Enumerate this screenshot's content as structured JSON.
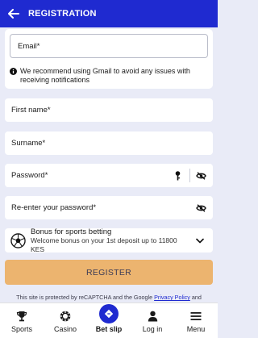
{
  "header": {
    "title": "REGISTRATION"
  },
  "email": {
    "label": "Email*",
    "notice": "We recommend using Gmail to avoid any issues with receiving notifications"
  },
  "fields": {
    "first_name": "First name*",
    "surname": "Surname*",
    "password": "Password*",
    "reenter_password": "Re-enter your password*"
  },
  "bonus": {
    "title": "Bonus for sports betting",
    "subtitle": "Welcome bonus on your 1st deposit up to 11800 KES"
  },
  "register_label": "REGISTER",
  "recaptcha": {
    "text": "This site is protected by reCAPTCHA and the Google",
    "link": "Privacy Policy",
    "suffix": "and"
  },
  "nav": {
    "sports": "Sports",
    "casino": "Casino",
    "betslip": "Bet slip",
    "login": "Log in",
    "menu": "Menu"
  },
  "colors": {
    "primary": "#1f2ad0",
    "register": "#ecb46f",
    "background": "#e9ebf7"
  }
}
